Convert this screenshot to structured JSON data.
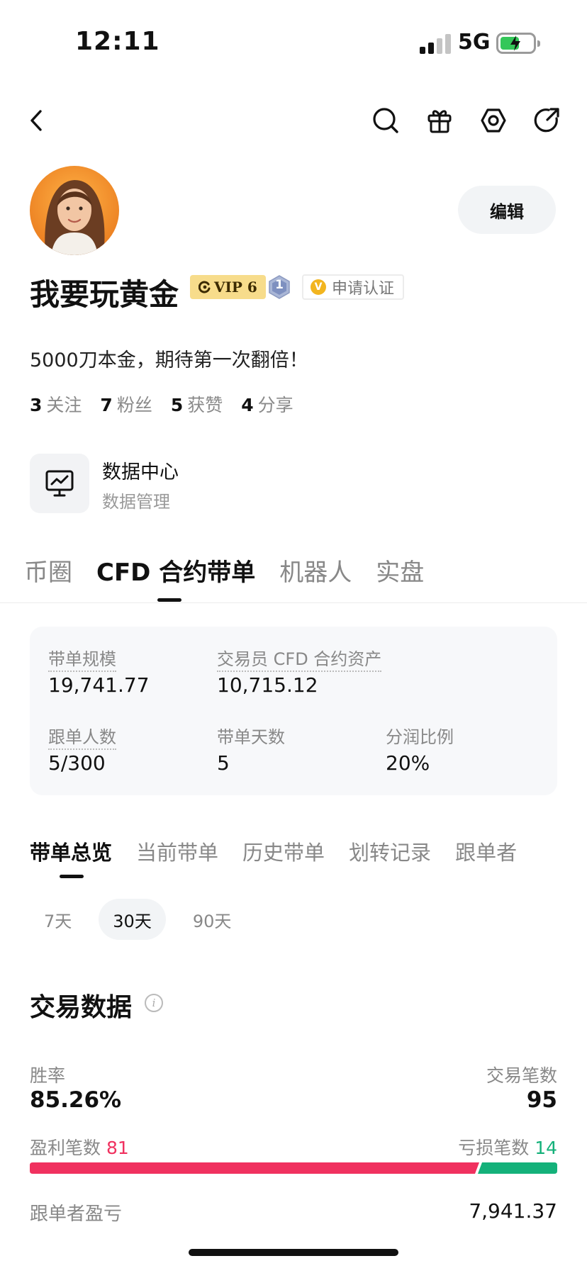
{
  "status_bar": {
    "time": "12:11",
    "network": "5G"
  },
  "profile": {
    "name": "我要玩黄金",
    "vip_badge": "VIP 6",
    "level_badge": "1",
    "apply_label": "申请认证",
    "verify_mark": "V",
    "edit_label": "编辑",
    "bio": "5000刀本金，期待第一次翻倍！",
    "stats": [
      {
        "number": "3",
        "label": "关注"
      },
      {
        "number": "7",
        "label": "粉丝"
      },
      {
        "number": "5",
        "label": "获赞"
      },
      {
        "number": "4",
        "label": "分享"
      }
    ]
  },
  "data_center": {
    "title": "数据中心",
    "subtitle": "数据管理"
  },
  "main_tabs": [
    "币圈",
    "CFD 合约带单",
    "机器人",
    "实盘"
  ],
  "main_tab_active": "CFD 合约带单",
  "card": {
    "scale_label": "带单规模",
    "scale_value": "19,741.77",
    "assets_label": "交易员 CFD 合约资产",
    "assets_value": "10,715.12",
    "followers_label": "跟单人数",
    "followers_value": "5/300",
    "days_label": "带单天数",
    "days_value": "5",
    "share_label": "分润比例",
    "share_value": "20%"
  },
  "sub_tabs": [
    "带单总览",
    "当前带单",
    "历史带单",
    "划转记录",
    "跟单者"
  ],
  "sub_tab_active": "带单总览",
  "periods": [
    "7天",
    "30天",
    "90天"
  ],
  "period_active": "30天",
  "trading": {
    "title": "交易数据",
    "win_rate_label": "胜率",
    "win_rate_value": "85.26%",
    "trades_label": "交易笔数",
    "trades_value": "95",
    "profit_label": "盈利笔数",
    "profit_count": "81",
    "loss_label": "亏损笔数",
    "loss_count": "14",
    "profit_fraction": 0.8526,
    "follower_pnl_label": "跟单者盈亏",
    "follower_pnl_value": "7,941.37"
  },
  "colors": {
    "profit": "#f0315f",
    "loss": "#14b17a",
    "vip": "#f7dc8b",
    "battery": "#34c759"
  }
}
